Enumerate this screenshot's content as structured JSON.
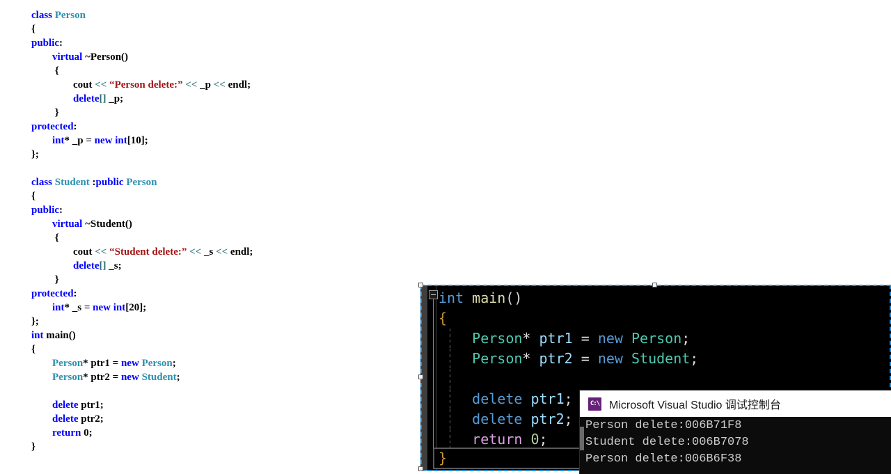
{
  "light_editor": {
    "name": "source-code-pane",
    "language": "C++",
    "lines": [
      [
        {
          "t": "class ",
          "c": "kw"
        },
        {
          "t": "Person",
          "c": "cls"
        }
      ],
      [
        {
          "t": "{",
          "c": "pln"
        }
      ],
      [
        {
          "t": "public",
          "c": "kw"
        },
        {
          "t": ":",
          "c": "pln"
        }
      ],
      [
        {
          "t": "        ",
          "c": "pln"
        },
        {
          "t": "virtual",
          "c": "kw"
        },
        {
          "t": " ~Person()",
          "c": "pln"
        }
      ],
      [
        {
          "t": "         {",
          "c": "pln"
        }
      ],
      [
        {
          "t": "                cout ",
          "c": "pln"
        },
        {
          "t": "<<",
          "c": "op"
        },
        {
          "t": " “Person delete:”",
          "c": "str"
        },
        {
          "t": " <<",
          "c": "op"
        },
        {
          "t": " _p ",
          "c": "pln"
        },
        {
          "t": "<<",
          "c": "op"
        },
        {
          "t": " endl;",
          "c": "pln"
        }
      ],
      [
        {
          "t": "                ",
          "c": "pln"
        },
        {
          "t": "delete",
          "c": "kw"
        },
        {
          "t": "[]",
          "c": "op"
        },
        {
          "t": " _p;",
          "c": "pln"
        }
      ],
      [
        {
          "t": "         }",
          "c": "pln"
        }
      ],
      [
        {
          "t": "protected",
          "c": "kw"
        },
        {
          "t": ":",
          "c": "pln"
        }
      ],
      [
        {
          "t": "        ",
          "c": "pln"
        },
        {
          "t": "int",
          "c": "kw"
        },
        {
          "t": "*",
          "c": "pln"
        },
        {
          "t": " _p = ",
          "c": "pln"
        },
        {
          "t": "new ",
          "c": "kw"
        },
        {
          "t": "int",
          "c": "kw"
        },
        {
          "t": "[10];",
          "c": "pln"
        }
      ],
      [
        {
          "t": "};",
          "c": "pln"
        }
      ],
      [
        {
          "t": "",
          "c": "pln"
        }
      ],
      [
        {
          "t": "class ",
          "c": "kw"
        },
        {
          "t": "Student",
          "c": "cls"
        },
        {
          "t": " :",
          "c": "pln"
        },
        {
          "t": "public ",
          "c": "kw"
        },
        {
          "t": "Person",
          "c": "cls"
        }
      ],
      [
        {
          "t": "{",
          "c": "pln"
        }
      ],
      [
        {
          "t": "public",
          "c": "kw"
        },
        {
          "t": ":",
          "c": "pln"
        }
      ],
      [
        {
          "t": "        ",
          "c": "pln"
        },
        {
          "t": "virtual",
          "c": "kw"
        },
        {
          "t": " ~Student()",
          "c": "pln"
        }
      ],
      [
        {
          "t": "         {",
          "c": "pln"
        }
      ],
      [
        {
          "t": "                cout ",
          "c": "pln"
        },
        {
          "t": "<<",
          "c": "op"
        },
        {
          "t": " “Student delete:”",
          "c": "str"
        },
        {
          "t": " <<",
          "c": "op"
        },
        {
          "t": " _s ",
          "c": "pln"
        },
        {
          "t": "<<",
          "c": "op"
        },
        {
          "t": " endl;",
          "c": "pln"
        }
      ],
      [
        {
          "t": "                ",
          "c": "pln"
        },
        {
          "t": "delete",
          "c": "kw"
        },
        {
          "t": "[]",
          "c": "op"
        },
        {
          "t": " _s;",
          "c": "pln"
        }
      ],
      [
        {
          "t": "         }",
          "c": "pln"
        }
      ],
      [
        {
          "t": "protected",
          "c": "kw"
        },
        {
          "t": ":",
          "c": "pln"
        }
      ],
      [
        {
          "t": "        ",
          "c": "pln"
        },
        {
          "t": "int",
          "c": "kw"
        },
        {
          "t": "*",
          "c": "pln"
        },
        {
          "t": " _s = ",
          "c": "pln"
        },
        {
          "t": "new ",
          "c": "kw"
        },
        {
          "t": "int",
          "c": "kw"
        },
        {
          "t": "[20];",
          "c": "pln"
        }
      ],
      [
        {
          "t": "};",
          "c": "pln"
        }
      ],
      [
        {
          "t": "int",
          "c": "kw"
        },
        {
          "t": " main()",
          "c": "pln"
        }
      ],
      [
        {
          "t": "{",
          "c": "pln"
        }
      ],
      [
        {
          "t": "        ",
          "c": "pln"
        },
        {
          "t": "Person",
          "c": "cls"
        },
        {
          "t": "*",
          "c": "pln"
        },
        {
          "t": " ptr1 = ",
          "c": "pln"
        },
        {
          "t": "new ",
          "c": "kw"
        },
        {
          "t": "Person",
          "c": "cls"
        },
        {
          "t": ";",
          "c": "pln"
        }
      ],
      [
        {
          "t": "        ",
          "c": "pln"
        },
        {
          "t": "Person",
          "c": "cls"
        },
        {
          "t": "*",
          "c": "pln"
        },
        {
          "t": " ptr2 = ",
          "c": "pln"
        },
        {
          "t": "new ",
          "c": "kw"
        },
        {
          "t": "Student",
          "c": "cls"
        },
        {
          "t": ";",
          "c": "pln"
        }
      ],
      [
        {
          "t": "",
          "c": "pln"
        }
      ],
      [
        {
          "t": "        ",
          "c": "pln"
        },
        {
          "t": "delete",
          "c": "kw"
        },
        {
          "t": " ptr1;",
          "c": "pln"
        }
      ],
      [
        {
          "t": "        ",
          "c": "pln"
        },
        {
          "t": "delete",
          "c": "kw"
        },
        {
          "t": " ptr2;",
          "c": "pln"
        }
      ],
      [
        {
          "t": "        ",
          "c": "pln"
        },
        {
          "t": "return",
          "c": "kw"
        },
        {
          "t": " 0;",
          "c": "pln"
        }
      ],
      [
        {
          "t": "}",
          "c": "pln"
        }
      ]
    ]
  },
  "dark_editor": {
    "name": "main-function-editor",
    "fold_state": "expanded",
    "lines": [
      {
        "indent": 0,
        "guide": false,
        "tokens": [
          {
            "t": "int",
            "c": "kw"
          },
          {
            "t": " ",
            "c": "pln"
          },
          {
            "t": "main",
            "c": "fn"
          },
          {
            "t": "()",
            "c": "pln"
          }
        ]
      },
      {
        "indent": 0,
        "guide": false,
        "tokens": [
          {
            "t": "{",
            "c": "brace"
          }
        ]
      },
      {
        "indent": 0,
        "guide": true,
        "tokens": [
          {
            "t": "    ",
            "c": "pln"
          },
          {
            "t": "Person",
            "c": "cls"
          },
          {
            "t": "* ",
            "c": "pln"
          },
          {
            "t": "ptr1",
            "c": "var"
          },
          {
            "t": " ",
            "c": "pln"
          },
          {
            "t": "=",
            "c": "pln"
          },
          {
            "t": " ",
            "c": "pln"
          },
          {
            "t": "new",
            "c": "kw"
          },
          {
            "t": " ",
            "c": "pln"
          },
          {
            "t": "Person",
            "c": "cls"
          },
          {
            "t": ";",
            "c": "pln"
          }
        ]
      },
      {
        "indent": 0,
        "guide": true,
        "tokens": [
          {
            "t": "    ",
            "c": "pln"
          },
          {
            "t": "Person",
            "c": "cls"
          },
          {
            "t": "* ",
            "c": "pln"
          },
          {
            "t": "ptr2",
            "c": "var"
          },
          {
            "t": " ",
            "c": "pln"
          },
          {
            "t": "=",
            "c": "pln"
          },
          {
            "t": " ",
            "c": "pln"
          },
          {
            "t": "new",
            "c": "kw"
          },
          {
            "t": " ",
            "c": "pln"
          },
          {
            "t": "Student",
            "c": "cls"
          },
          {
            "t": ";",
            "c": "pln"
          }
        ]
      },
      {
        "indent": 0,
        "guide": true,
        "tokens": [
          {
            "t": "",
            "c": "pln"
          }
        ]
      },
      {
        "indent": 0,
        "guide": true,
        "tokens": [
          {
            "t": "    ",
            "c": "pln"
          },
          {
            "t": "delete",
            "c": "kw"
          },
          {
            "t": " ",
            "c": "pln"
          },
          {
            "t": "ptr1",
            "c": "var"
          },
          {
            "t": ";",
            "c": "pln"
          }
        ]
      },
      {
        "indent": 0,
        "guide": true,
        "tokens": [
          {
            "t": "    ",
            "c": "pln"
          },
          {
            "t": "delete",
            "c": "kw"
          },
          {
            "t": " ",
            "c": "pln"
          },
          {
            "t": "ptr2",
            "c": "var"
          },
          {
            "t": ";",
            "c": "pln"
          }
        ]
      },
      {
        "indent": 0,
        "guide": true,
        "tokens": [
          {
            "t": "    ",
            "c": "pln"
          },
          {
            "t": "return",
            "c": "ctl"
          },
          {
            "t": " ",
            "c": "pln"
          },
          {
            "t": "0",
            "c": "num"
          },
          {
            "t": ";",
            "c": "pln"
          }
        ]
      }
    ],
    "current_line": "}"
  },
  "console": {
    "title": "Microsoft Visual Studio 调试控制台",
    "icon_label": "C:\\",
    "output_lines": [
      "Person delete:006B71F8",
      "Student delete:006B7078",
      "Person delete:006B6F38"
    ]
  },
  "colors": {
    "light_keyword": "#0000FF",
    "light_class": "#2B91AF",
    "light_string": "#A31515",
    "light_operator": "#2B6F74",
    "dark_background": "#000000",
    "dark_keyword": "#569CD6",
    "dark_class": "#4EC9B0",
    "dark_variable": "#9CDCFE",
    "dark_control": "#D8A0DF",
    "dark_number": "#B5CEA8",
    "selection_border": "#1E8FE0",
    "console_background": "#0C0C0C",
    "console_icon": "#68217A"
  }
}
